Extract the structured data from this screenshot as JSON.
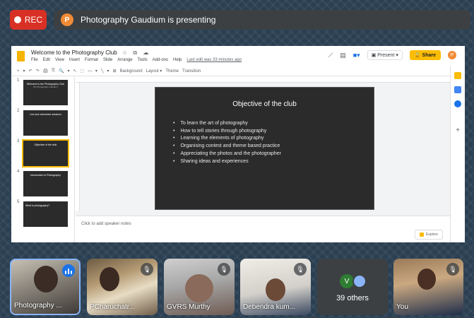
{
  "meeting": {
    "rec_label": "REC",
    "presenter_initial": "P",
    "presenting_text": "Photography Gaudium is presenting"
  },
  "slides_app": {
    "doc_title": "Welcome to the  Photography Club",
    "doc_icons": "☆ ⧉ ☁",
    "menu": [
      "File",
      "Edit",
      "View",
      "Insert",
      "Format",
      "Slide",
      "Arrange",
      "Tools",
      "Add-ons",
      "Help"
    ],
    "last_edit": "Last edit was 33 minutes ago",
    "present_label": "Present",
    "share_label": "Share",
    "user_initial": "P",
    "toolbar": [
      "+",
      "▾",
      "↶",
      "↷",
      "🖨",
      "⎘",
      "🔍",
      "▾",
      "↖",
      "⬚",
      "▭",
      "▾",
      "╲",
      "▾",
      "⊞",
      "Background",
      "Layout ▾",
      "Theme",
      "Transition"
    ],
    "thumbnails": [
      {
        "num": "1",
        "title": "Welcome to the Photography Club",
        "sub": "By Photography Gaudium"
      },
      {
        "num": "2",
        "title": "Live and Interactive sessions",
        "sub": ""
      },
      {
        "num": "3",
        "title": "Objective of the club",
        "sub": "",
        "selected": true
      },
      {
        "num": "4",
        "title": "Introduction to Photography",
        "sub": ""
      },
      {
        "num": "5",
        "title": "What is photography?",
        "sub": ""
      }
    ],
    "slide": {
      "title": "Objective of the club",
      "bullets": [
        "To learn the art of photography",
        "How to tell stories through photography",
        "Learning the elements of photography",
        "Organising contest and theme based practice",
        "Appreciating the photos and the photographer",
        "Sharing ideas and experiences"
      ]
    },
    "speaker_notes_placeholder": "Click to add speaker notes",
    "explore_label": "Explore",
    "side_panel_colors": [
      "#fbbc04",
      "#4285f4",
      "#1a73e8"
    ]
  },
  "participants": [
    {
      "name": "Photography ...",
      "speaking": true
    },
    {
      "name": "PCharuchatr...",
      "muted": true
    },
    {
      "name": "GVRS Murthy",
      "muted": true
    },
    {
      "name": "Debendra kum...",
      "muted": true
    },
    {
      "others_initial": "V",
      "others_count": "39 others"
    },
    {
      "name": "You",
      "muted": true
    }
  ]
}
